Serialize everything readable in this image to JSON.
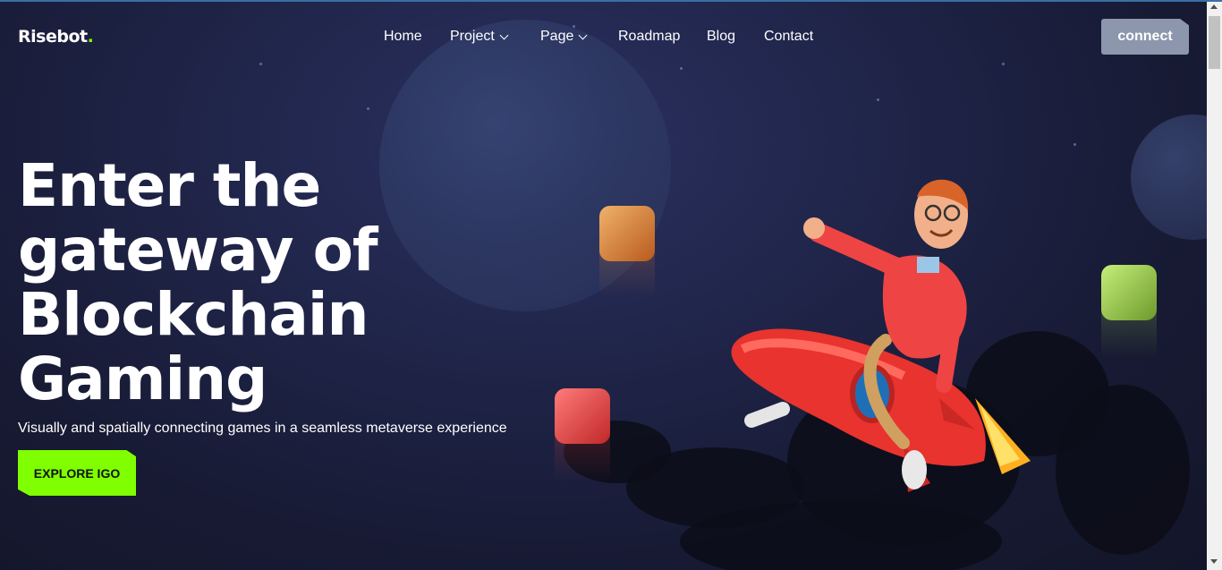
{
  "brand": {
    "name": "Risebot",
    "dot": "."
  },
  "nav": {
    "items": [
      {
        "label": "Home",
        "dropdown": false
      },
      {
        "label": "Project",
        "dropdown": true
      },
      {
        "label": "Page",
        "dropdown": true
      },
      {
        "label": "Roadmap",
        "dropdown": false
      },
      {
        "label": "Blog",
        "dropdown": false
      },
      {
        "label": "Contact",
        "dropdown": false
      }
    ],
    "connect_label": "connect"
  },
  "hero": {
    "title_lines": [
      "Enter the",
      "gateway of",
      "Blockchain",
      "Gaming"
    ],
    "subtitle": "Visually and spatially connecting games in a seamless metaverse experience",
    "cta_label": "EXPLORE IGO"
  },
  "colors": {
    "accent": "#7fff00",
    "connect_bg": "#8c97ad",
    "background": "#1b1f3d"
  }
}
